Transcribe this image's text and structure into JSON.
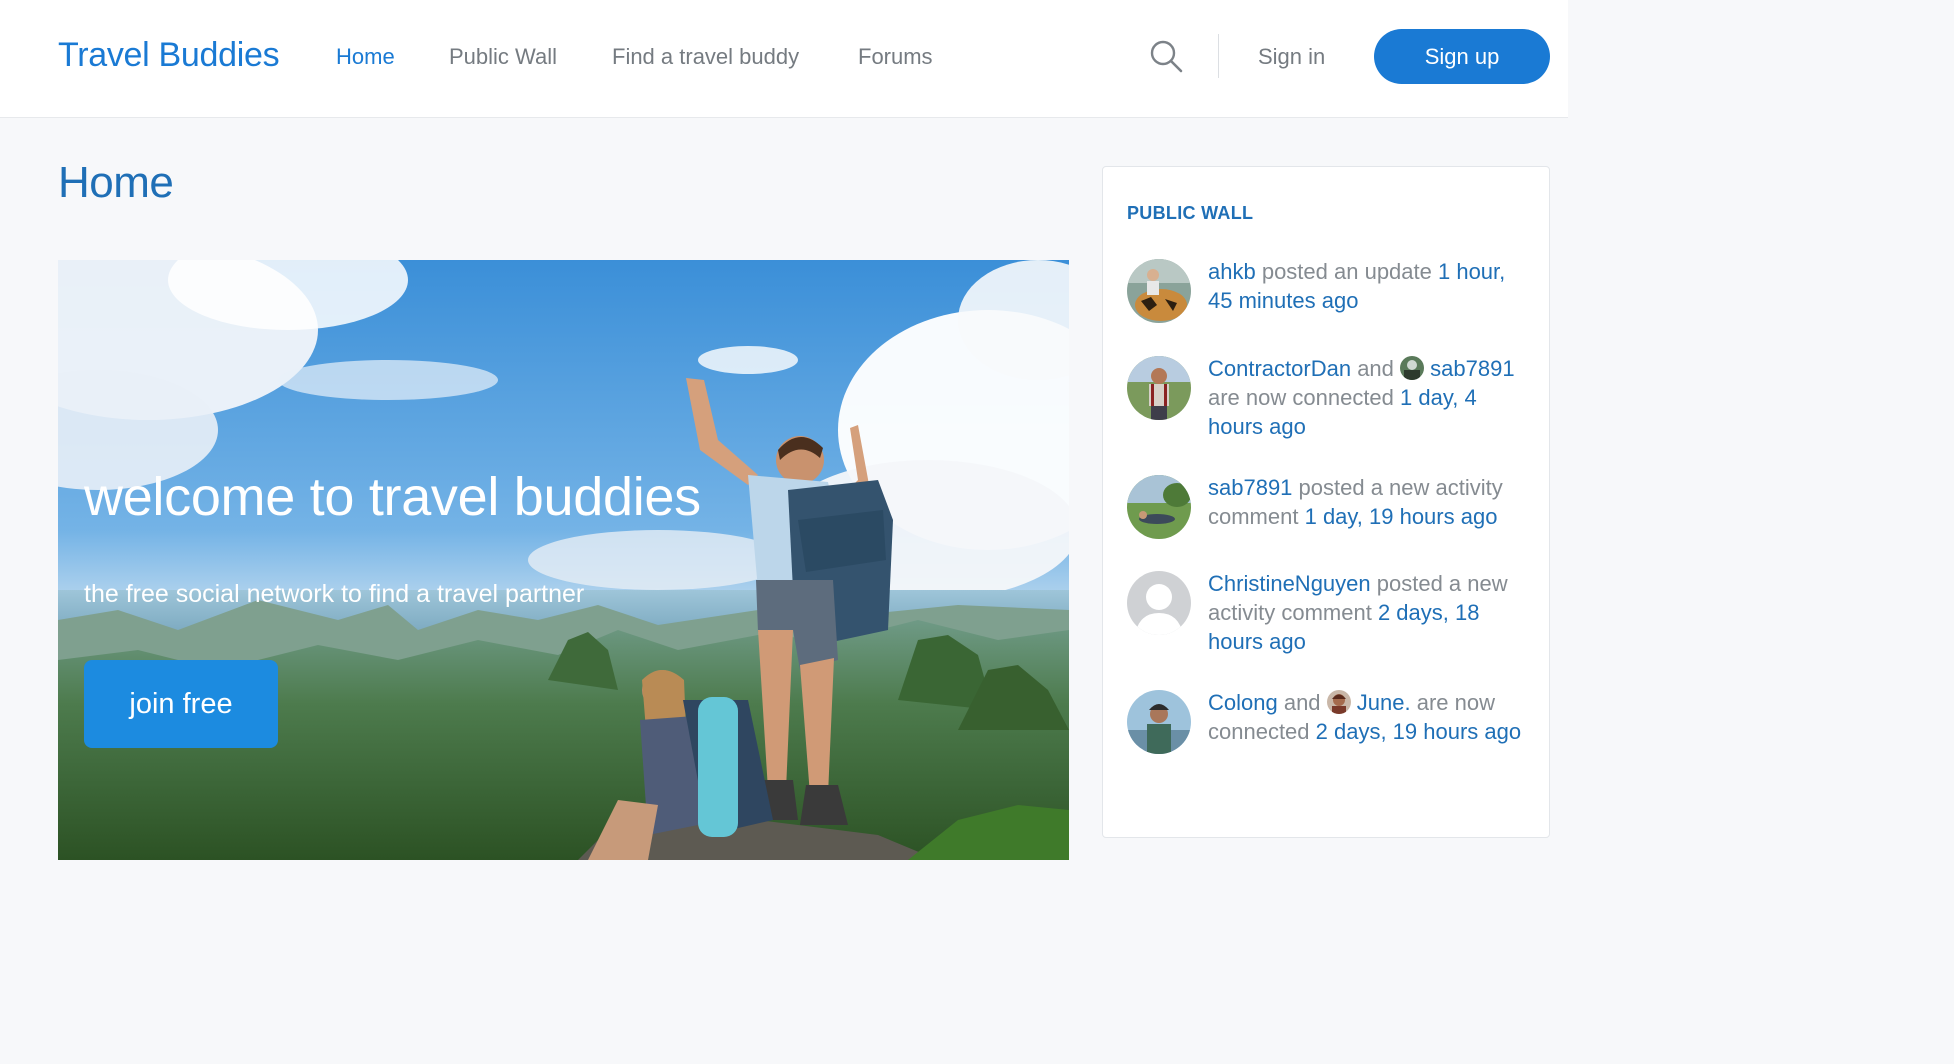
{
  "header": {
    "brand": "Travel Buddies",
    "nav": [
      {
        "label": "Home",
        "active": true
      },
      {
        "label": "Public Wall",
        "active": false
      },
      {
        "label": "Find a travel buddy",
        "active": false
      },
      {
        "label": "Forums",
        "active": false
      }
    ],
    "search_icon": "search-icon",
    "signin": "Sign in",
    "signup": "Sign up"
  },
  "main": {
    "title": "Home",
    "hero": {
      "title": "welcome to travel buddies",
      "subtitle": "the free social network to find a travel partner",
      "cta": "join free"
    }
  },
  "sidebar": {
    "title": "PUBLIC WALL",
    "activities": [
      {
        "user": "ahkb",
        "action": " posted an update ",
        "time": "1 hour, 45 minutes ago"
      },
      {
        "user": "ContractorDan",
        "conj": " and ",
        "user2": "sab7891",
        "action": " are now connected ",
        "time": "1 day, 4 hours ago"
      },
      {
        "user": "sab7891",
        "action": " posted a new activity comment ",
        "time": "1 day, 19 hours ago"
      },
      {
        "user": "ChristineNguyen",
        "action": " posted a new activity comment ",
        "time": "2 days, 18 hours ago"
      },
      {
        "user": "Colong",
        "conj": " and ",
        "user2": "June.",
        "action": " are now connected ",
        "time": "2 days, 19 hours ago"
      }
    ]
  },
  "colors": {
    "brand": "#1a7ad4",
    "link": "#1f6fb6",
    "cta": "#1c8be0",
    "muted_text": "#858b91"
  }
}
